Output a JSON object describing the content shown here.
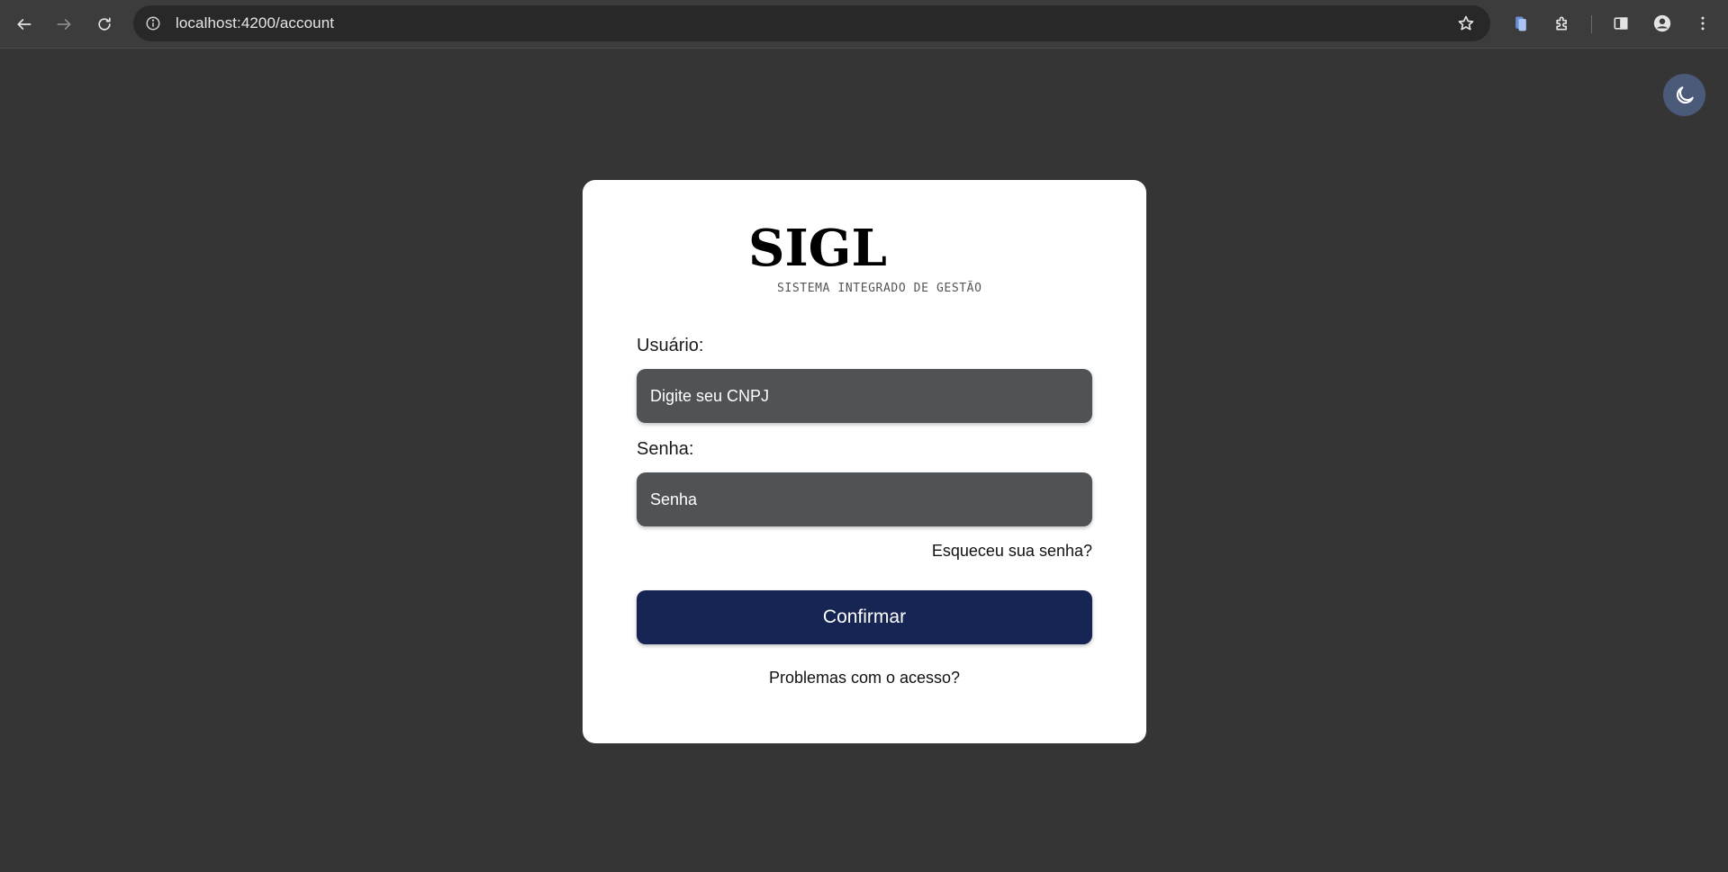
{
  "browser": {
    "url": "localhost:4200/account"
  },
  "login": {
    "logo": "SIGL",
    "tagline": "SISTEMA INTEGRADO DE GESTÃO",
    "user_label": "Usuário:",
    "user_placeholder": "Digite seu CNPJ",
    "password_label": "Senha:",
    "password_placeholder": "Senha",
    "forgot_link": "Esqueceu sua senha?",
    "confirm_button": "Confirmar",
    "problems_link": "Problemas com o acesso?"
  },
  "colors": {
    "page_background": "#353535",
    "card_background": "#ffffff",
    "input_background": "#505356",
    "confirm_button": "#172554",
    "theme_toggle": "#4a5a78"
  },
  "icons": {
    "theme_toggle": "moon-icon"
  }
}
